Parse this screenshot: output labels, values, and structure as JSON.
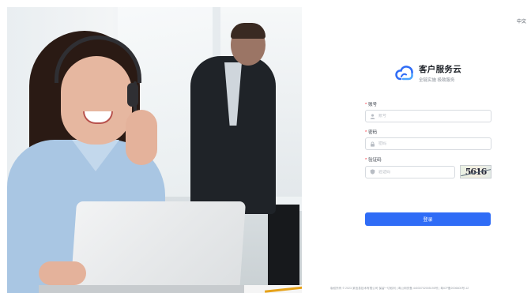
{
  "header": {
    "language_label": "中文"
  },
  "brand": {
    "title": "客户服务云",
    "subtitle": "全链实施 极致服务",
    "logo_icon": "cloud-logo-icon",
    "accent_color": "#2f6cf6"
  },
  "form": {
    "account": {
      "label": "账号",
      "placeholder": "账号",
      "icon": "user-icon"
    },
    "password": {
      "label": "密码",
      "placeholder": "密码",
      "icon": "lock-icon"
    },
    "captcha": {
      "label": "验证码",
      "placeholder": "验证码",
      "icon": "shield-icon",
      "image_text": "5616"
    },
    "required_mark": "*"
  },
  "actions": {
    "login_label": "登录"
  },
  "footer": {
    "text": "版权所有 © 2023 某信息技术有限公司 保留一切权利 | 粤公网安备 44030702005195号 | 粤ICP备2006600号-12"
  }
}
